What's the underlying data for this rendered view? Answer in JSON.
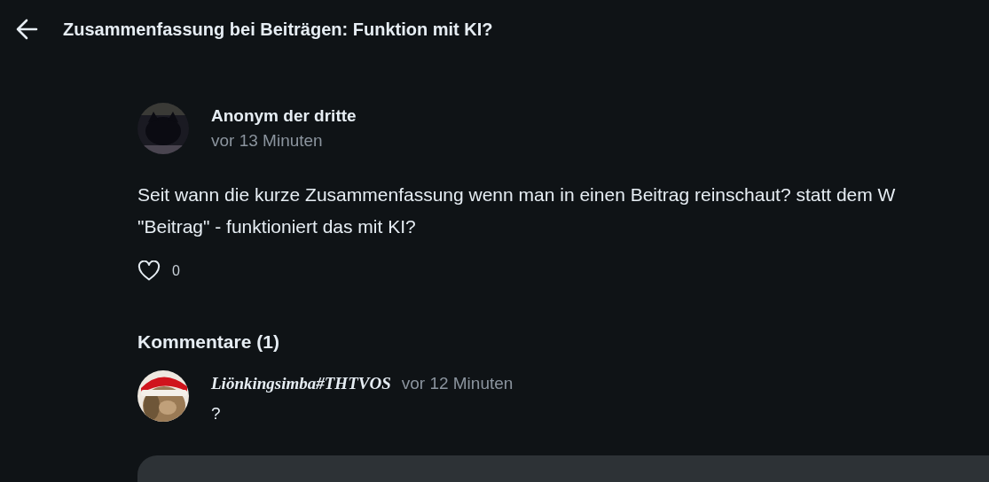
{
  "header": {
    "title": "Zusammenfassung bei Beiträgen: Funktion mit KI?"
  },
  "post": {
    "author": "Anonym der dritte",
    "time": "vor 13 Minuten",
    "body": "Seit wann die kurze Zusammenfassung wenn man in einen Beitrag reinschaut? statt dem W\n\"Beitrag\" - funktioniert das mit KI?",
    "likes": "0",
    "liked": false
  },
  "comments": {
    "heading": "Kommentare (1)",
    "items": [
      {
        "author": "Liönkingsimba#THTVOS",
        "time": "vor 12 Minuten",
        "text": "?"
      }
    ]
  }
}
